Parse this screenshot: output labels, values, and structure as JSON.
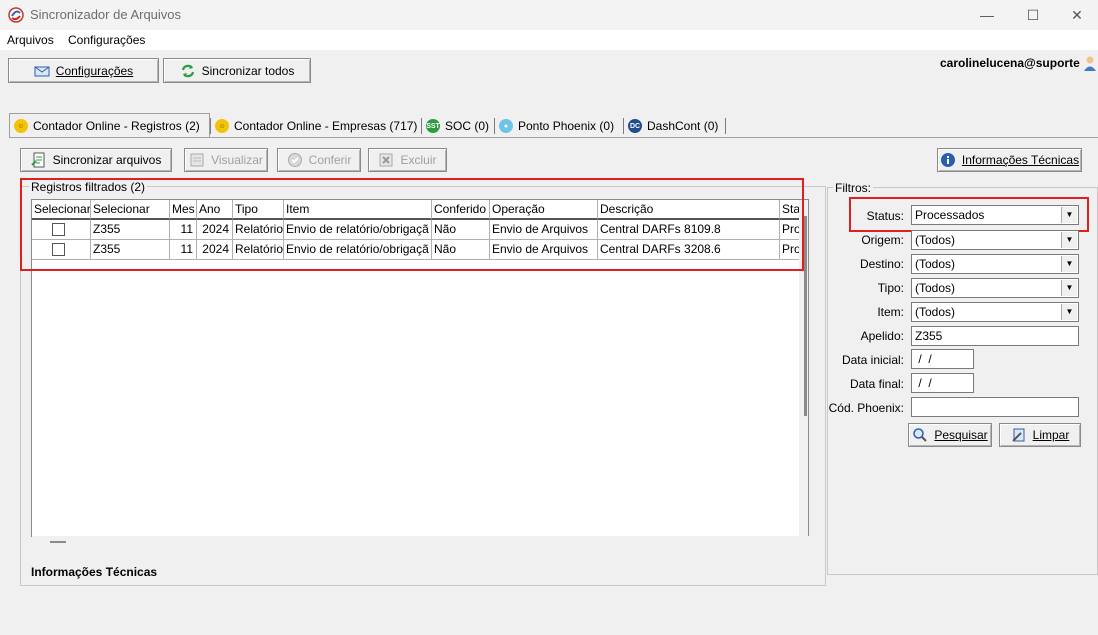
{
  "window": {
    "title": "Sincronizador de Arquivos",
    "min": "—",
    "max": "☐",
    "close": "✕"
  },
  "menu": {
    "items": [
      "Arquivos",
      "Configurações"
    ]
  },
  "toolbar": {
    "config_label": "Configurações",
    "sync_all_label": "Sincronizar todos"
  },
  "user": {
    "name": "carolinelucena@suporte"
  },
  "tabs": [
    {
      "label": "Contador Online - Registros (2)"
    },
    {
      "label": "Contador Online - Empresas (717)"
    },
    {
      "label": "SOC (0)",
      "badge": "SST"
    },
    {
      "label": "Ponto Phoenix (0)"
    },
    {
      "label": "DashCont (0)",
      "badge": "DC"
    }
  ],
  "actions": {
    "sync_files": "Sincronizar arquivos",
    "view": "Visualizar",
    "check": "Conferir",
    "delete": "Excluir",
    "tech_info": "Informações Técnicas"
  },
  "registros": {
    "group_label": "Registros filtrados (2)",
    "columns": [
      "Selecionar",
      "Selecionar",
      "Mes",
      "Ano",
      "Tipo",
      "Item",
      "Conferido",
      "Operação",
      "Descrição",
      "Sta"
    ],
    "rows": [
      {
        "codigo": "Z355",
        "mes": "11",
        "ano": "2024",
        "tipo": "Relatório",
        "item": "Envio de relatório/obrigaçã",
        "conferido": "Não",
        "operacao": "Envio de Arquivos",
        "descricao": "Central DARFs 8109.8",
        "status": "Pro"
      },
      {
        "codigo": "Z355",
        "mes": "11",
        "ano": "2024",
        "tipo": "Relatório",
        "item": "Envio de relatório/obrigaçã",
        "conferido": "Não",
        "operacao": "Envio de Arquivos",
        "descricao": "Central DARFs 3208.6",
        "status": "Pro"
      }
    ]
  },
  "bottom": {
    "tech_info_label": "Informações Técnicas"
  },
  "filters": {
    "group_label": "Filtros:",
    "status_label": "Status:",
    "status_value": "Processados",
    "origem_label": "Origem:",
    "origem_value": "(Todos)",
    "destino_label": "Destino:",
    "destino_value": "(Todos)",
    "tipo_label": "Tipo:",
    "tipo_value": "(Todos)",
    "item_label": "Item:",
    "item_value": "(Todos)",
    "apelido_label": "Apelido:",
    "apelido_value": "Z355",
    "data_inicial_label": "Data inicial:",
    "data_inicial_value": " /  /",
    "data_final_label": "Data final:",
    "data_final_value": " /  /",
    "cod_phoenix_label": "Cód. Phoenix:",
    "cod_phoenix_value": "",
    "search_label": "Pesquisar",
    "clear_label": "Limpar"
  },
  "colors": {
    "highlight": "#e0201c",
    "tab_yellow": "#f4c400",
    "soc_green": "#2e9b43",
    "dash_blue": "#1f4e8c"
  }
}
